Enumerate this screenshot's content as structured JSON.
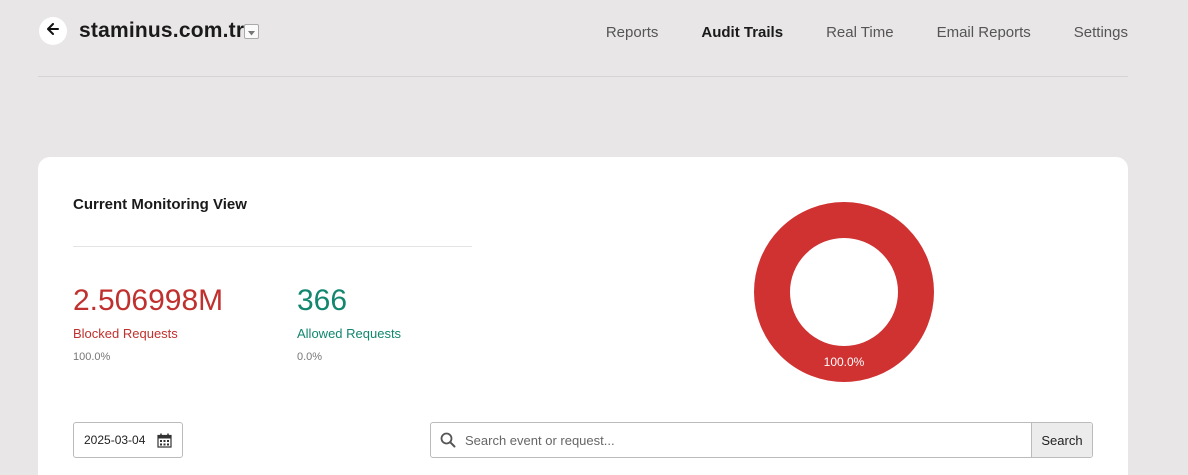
{
  "header": {
    "site_name": "staminus.com.tr",
    "back_icon": "arrow-left-icon",
    "dropdown_icon": "caret-down-icon",
    "nav": [
      {
        "label": "Reports",
        "active": false
      },
      {
        "label": "Audit Trails",
        "active": true
      },
      {
        "label": "Real Time",
        "active": false
      },
      {
        "label": "Email Reports",
        "active": false
      },
      {
        "label": "Settings",
        "active": false
      }
    ]
  },
  "monitoring": {
    "title": "Current Monitoring View",
    "blocked": {
      "value": "2.506998M",
      "label": "Blocked Requests",
      "percent": "100.0%"
    },
    "allowed": {
      "value": "366",
      "label": "Allowed Requests",
      "percent": "0.0%"
    },
    "donut": {
      "label": "100.0%",
      "blocked_fraction": 1.0,
      "allowed_fraction": 0.0,
      "blocked_color": "#d03131",
      "allowed_color": "#12866f"
    }
  },
  "filters": {
    "date": "2025-03-04",
    "date_icon": "calendar-icon",
    "search_placeholder": "Search event or request...",
    "search_value": "",
    "search_button": "Search",
    "search_icon": "magnifier-icon"
  },
  "colors": {
    "background": "#e8e6e7",
    "card": "#ffffff",
    "blocked": "#c0302e",
    "allowed": "#12866f"
  }
}
